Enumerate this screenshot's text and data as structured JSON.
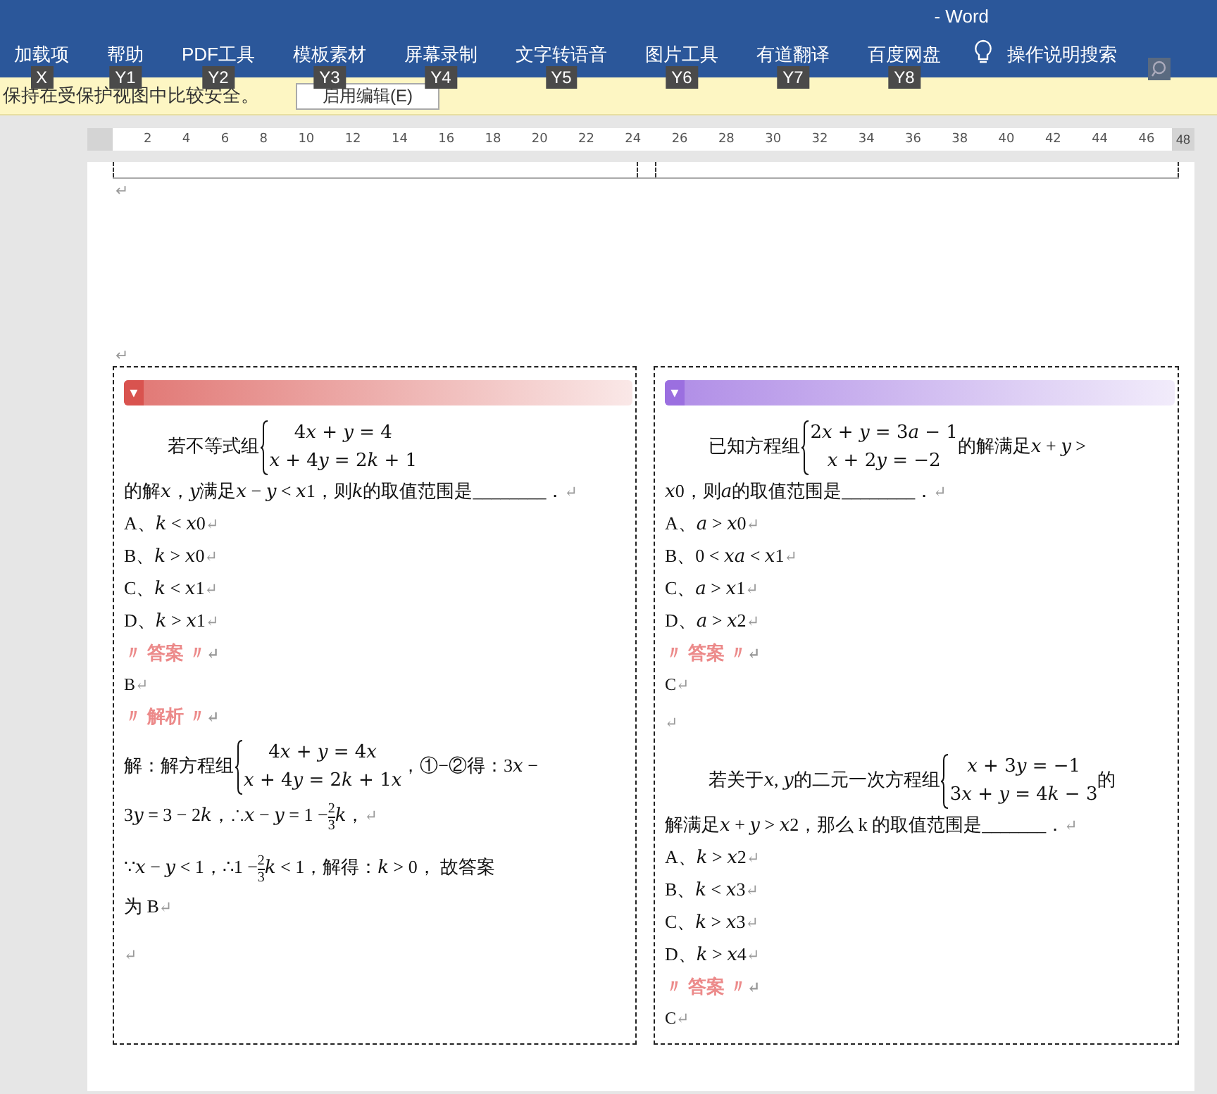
{
  "window": {
    "title": "- Word"
  },
  "ribbon_tabs": [
    {
      "label": "加载项",
      "keytip": "X"
    },
    {
      "label": "帮助",
      "keytip": "Y1"
    },
    {
      "label": "PDF工具",
      "keytip": "Y2"
    },
    {
      "label": "模板素材",
      "keytip": "Y3"
    },
    {
      "label": "屏幕录制",
      "keytip": "Y4"
    },
    {
      "label": "文字转语音",
      "keytip": "Y5"
    },
    {
      "label": "图片工具",
      "keytip": "Y6"
    },
    {
      "label": "有道翻译",
      "keytip": "Y7"
    },
    {
      "label": "百度网盘",
      "keytip": "Y8"
    }
  ],
  "tell_me": {
    "label": "操作说明搜索"
  },
  "protected_view_bar": {
    "message": "保持在受保护视图中比较安全。",
    "button": "启用编辑(E)"
  },
  "ruler": {
    "labels": [
      "2",
      "4",
      "6",
      "8",
      "10",
      "12",
      "14",
      "16",
      "18",
      "20",
      "22",
      "24",
      "26",
      "28",
      "30",
      "32",
      "34",
      "36",
      "38",
      "40",
      "42",
      "44",
      "46"
    ],
    "end_label": "48"
  },
  "page": {
    "header_marks": [
      "↵",
      "↵"
    ],
    "columns": [
      {
        "color": "#d9534f",
        "banner_icon": "▼",
        "paragraphs": [
          {
            "kind": "question",
            "segments": [
              {
                "kind": "text",
                "text": "若不等式组"
              },
              {
                "kind": "system",
                "lines": [
                  "4𝑥 + 𝑦 = 4",
                  "𝑥 + 4𝑦 = 2𝑘 + 1"
                ]
              },
              {
                "kind": "break"
              },
              {
                "kind": "text",
                "text": "的解𝑥，𝑦满足𝑥 − 𝑦 < 𝑥1，则𝑘的取值范围是________．"
              }
            ],
            "return_mark": "↵"
          },
          {
            "kind": "plain",
            "segments": [
              {
                "kind": "text",
                "text": "A、𝑘 < 𝑥0"
              }
            ],
            "return_mark": "↵"
          },
          {
            "kind": "plain",
            "segments": [
              {
                "kind": "text",
                "text": "B、𝑘 > 𝑥0"
              }
            ],
            "return_mark": "↵"
          },
          {
            "kind": "plain",
            "segments": [
              {
                "kind": "text",
                "text": "C、𝑘 < 𝑥1"
              }
            ],
            "return_mark": "↵"
          },
          {
            "kind": "plain",
            "segments": [
              {
                "kind": "text",
                "text": "D、𝑘 > 𝑥1"
              }
            ],
            "return_mark": "↵"
          },
          {
            "kind": "heading",
            "segments": [
              {
                "kind": "text",
                "text": "〃 答案 〃"
              }
            ],
            "return_mark": "↵"
          },
          {
            "kind": "small",
            "segments": [
              {
                "kind": "text",
                "text": "B"
              }
            ],
            "return_mark": "↵"
          },
          {
            "kind": "heading",
            "segments": [
              {
                "kind": "text",
                "text": "〃 解析 〃"
              }
            ],
            "return_mark": "↵"
          },
          {
            "kind": "solution",
            "segments": [
              {
                "kind": "text",
                "text": "解：解方程组"
              },
              {
                "kind": "system",
                "lines": [
                  "4𝑥 + 𝑦 = 4𝑥",
                  "𝑥 + 4𝑦 = 2𝑘 + 1𝑥"
                ]
              },
              {
                "kind": "text",
                "text": "，①−②得：3𝑥 −"
              },
              {
                "kind": "break"
              },
              {
                "kind": "text",
                "text": "3𝑦 = 3 − 2𝑘，∴𝑥 − 𝑦 = 1 −"
              },
              {
                "kind": "frac",
                "numerator": "2",
                "denominator": "3"
              },
              {
                "kind": "text",
                "text": "𝑘，"
              }
            ],
            "return_mark": "↵"
          },
          {
            "kind": "solution",
            "segments": [
              {
                "kind": "text",
                "text": "∵𝑥 − 𝑦 < 1，∴1 −"
              },
              {
                "kind": "frac",
                "numerator": "2",
                "denominator": "3"
              },
              {
                "kind": "text",
                "text": "𝑘 < 1，解得：𝑘 > 0， 故答案"
              },
              {
                "kind": "break"
              },
              {
                "kind": "text",
                "text": "为 B"
              }
            ],
            "return_mark": "↵"
          },
          {
            "kind": "plain",
            "return_mark": "↵"
          }
        ]
      },
      {
        "color": "#9b6fe0",
        "banner_icon": "▼",
        "paragraphs": [
          {
            "kind": "question",
            "segments": [
              {
                "kind": "text",
                "text": "已知方程组"
              },
              {
                "kind": "system",
                "lines": [
                  "2𝑥 + 𝑦 = 3𝑎 − 1",
                  "𝑥 + 2𝑦 = −2"
                ]
              },
              {
                "kind": "text",
                "text": "的解满足𝑥 + 𝑦 >"
              },
              {
                "kind": "break"
              },
              {
                "kind": "text",
                "text": "𝑥0，则𝑎的取值范围是________．"
              }
            ],
            "return_mark": "↵"
          },
          {
            "kind": "plain",
            "segments": [
              {
                "kind": "text",
                "text": "A、𝑎 > 𝑥0"
              }
            ],
            "return_mark": "↵"
          },
          {
            "kind": "plain",
            "segments": [
              {
                "kind": "text",
                "text": "B、0 < 𝑥𝑎 < 𝑥1"
              }
            ],
            "return_mark": "↵"
          },
          {
            "kind": "plain",
            "segments": [
              {
                "kind": "text",
                "text": "C、𝑎 > 𝑥1"
              }
            ],
            "return_mark": "↵"
          },
          {
            "kind": "plain",
            "segments": [
              {
                "kind": "text",
                "text": "D、𝑎 > 𝑥2"
              }
            ],
            "return_mark": "↵"
          },
          {
            "kind": "heading",
            "segments": [
              {
                "kind": "text",
                "text": "〃 答案 〃"
              }
            ],
            "return_mark": "↵"
          },
          {
            "kind": "small",
            "segments": [
              {
                "kind": "text",
                "text": "C"
              }
            ],
            "return_mark": "↵"
          },
          {
            "kind": "gap",
            "return_mark": "↵"
          },
          {
            "kind": "question",
            "segments": [
              {
                "kind": "text",
                "text": "若关于𝑥, 𝑦的二元一次方程组"
              },
              {
                "kind": "system",
                "lines": [
                  "𝑥 + 3𝑦 = −1",
                  "3𝑥 + 𝑦 = 4𝑘 − 3"
                ]
              },
              {
                "kind": "text",
                "text": "的"
              },
              {
                "kind": "break"
              },
              {
                "kind": "text",
                "text": "解满足𝑥 + 𝑦 > 𝑥2，那么 k 的取值范围是_______．"
              }
            ],
            "return_mark": "↵"
          },
          {
            "kind": "plain",
            "segments": [
              {
                "kind": "text",
                "text": "A、𝑘 > 𝑥2"
              }
            ],
            "return_mark": "↵"
          },
          {
            "kind": "plain",
            "segments": [
              {
                "kind": "text",
                "text": "B、𝑘 < 𝑥3"
              }
            ],
            "return_mark": "↵"
          },
          {
            "kind": "plain",
            "segments": [
              {
                "kind": "text",
                "text": "C、𝑘 > 𝑥3"
              }
            ],
            "return_mark": "↵"
          },
          {
            "kind": "plain",
            "segments": [
              {
                "kind": "text",
                "text": "D、𝑘 > 𝑥4"
              }
            ],
            "return_mark": "↵"
          },
          {
            "kind": "heading",
            "segments": [
              {
                "kind": "text",
                "text": "〃 答案 〃"
              }
            ],
            "return_mark": "↵"
          },
          {
            "kind": "small",
            "segments": [
              {
                "kind": "text",
                "text": "C"
              }
            ],
            "return_mark": "↵"
          }
        ]
      }
    ]
  }
}
